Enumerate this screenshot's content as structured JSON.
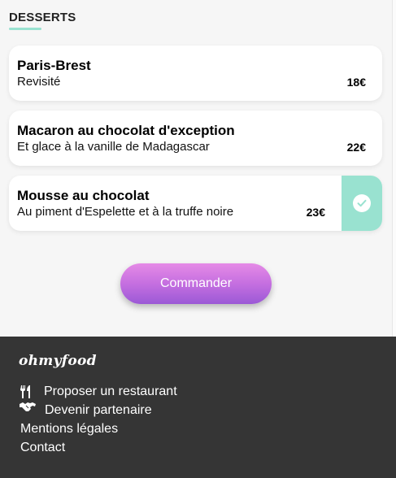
{
  "section": {
    "title": "DESSERTS"
  },
  "menu_items": [
    {
      "name": "Paris-Brest",
      "description": "Revisité",
      "price": "18€",
      "selected": false
    },
    {
      "name": "Macaron au chocolat d'exception",
      "description": "Et glace à la vanille de Madagascar",
      "price": "22€",
      "selected": false
    },
    {
      "name": "Mousse au chocolat",
      "description": "Au piment d'Espelette et à la truffe noire",
      "price": "23€",
      "selected": true
    }
  ],
  "order_button": {
    "label": "Commander"
  },
  "footer": {
    "logo": "ohmyfood",
    "links": [
      {
        "label": "Proposer un restaurant",
        "icon": "utensils-icon"
      },
      {
        "label": "Devenir partenaire",
        "icon": "handshake-icon"
      },
      {
        "label": "Mentions légales"
      },
      {
        "label": "Contact"
      }
    ]
  },
  "colors": {
    "accent_mint": "#99e2d0",
    "button_gradient_top": "#e58ae6",
    "button_gradient_bottom": "#9b59d6",
    "footer_bg": "#353535"
  }
}
